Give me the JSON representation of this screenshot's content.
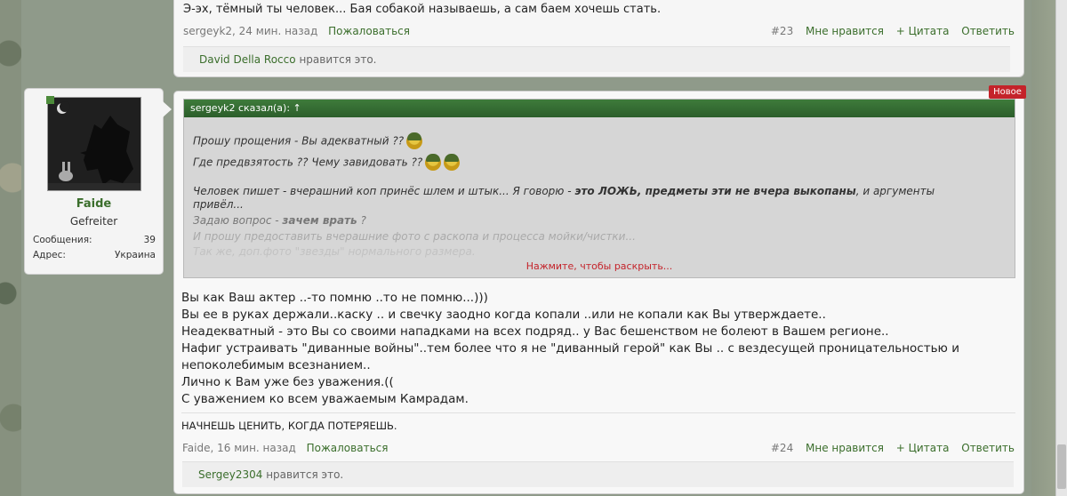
{
  "prev_post": {
    "message": "Э-эх, тёмный ты человек... Бая собакой называешь, а сам баем хочешь стать.",
    "author": "sergeyk2",
    "time": ", 24 мин. назад",
    "report": "Пожаловаться",
    "post_number": "#23",
    "like": "Мне нравится",
    "quote": "+ Цитата",
    "reply": "Ответить",
    "liked_by": "David Della Rocco",
    "liked_suffix": "нравится это."
  },
  "user": {
    "name": "Faide",
    "rank": "Gefreiter",
    "messages_label": "Сообщения:",
    "messages_value": "39",
    "address_label": "Адрес:",
    "address_value": "Украина"
  },
  "post": {
    "badge": "Новое",
    "quote_header": "sergeyk2 сказал(а): ↑",
    "quote_lines": {
      "l1": "Прошу прощения - Вы адекватный ??",
      "l2": "Где предвзятость ?? Чему завидовать ??",
      "l3a": "Человек пишет - вчерашний коп принёс шлем и штык... Я говорю - ",
      "l3b": "это ЛОЖЬ, предметы эти не вчера выкопаны",
      "l3c": ", и аргументы",
      "l4": "привёл...",
      "l5a": "Задаю вопрос - ",
      "l5b": "зачем врать",
      "l5c": " ?",
      "l6": "И прошу предоставить вчерашние фото с раскопа и процесса мойки/чистки...",
      "l7": "Так же, доп.фото \"звезды\" нормального размера."
    },
    "expand": "Нажмите, чтобы раскрыть...",
    "body": [
      "Вы как Ваш актер ..-то помню ..то не помню...)))",
      "Вы ее в руках держали..каску .. и свечку заодно когда копали ..или не копали как Вы утверждаете..",
      "Неадекватный - это Вы со своими нападками на всех подряд.. у Вас бешенством не болеют в Вашем регионе..",
      "Нафиг устраивать \"диванные войны\"..тем более что я не \"диванный герой\" как Вы .. с вездесущей проницательностью и",
      "непоколебимым всезнанием..",
      "Лично к Вам уже без уважения.((",
      "С уважением ко всем уважаемым Камрадам."
    ],
    "signature": "НАЧНЕШЬ ЦЕНИТЬ, КОГДА ПОТЕРЯЕШЬ.",
    "author": "Faide",
    "time": ", 16 мин. назад",
    "report": "Пожаловаться",
    "post_number": "#24",
    "like": "Мне нравится",
    "quote": "+ Цитата",
    "reply": "Ответить",
    "liked_by": "Sergey2304",
    "liked_suffix": "нравится это."
  }
}
